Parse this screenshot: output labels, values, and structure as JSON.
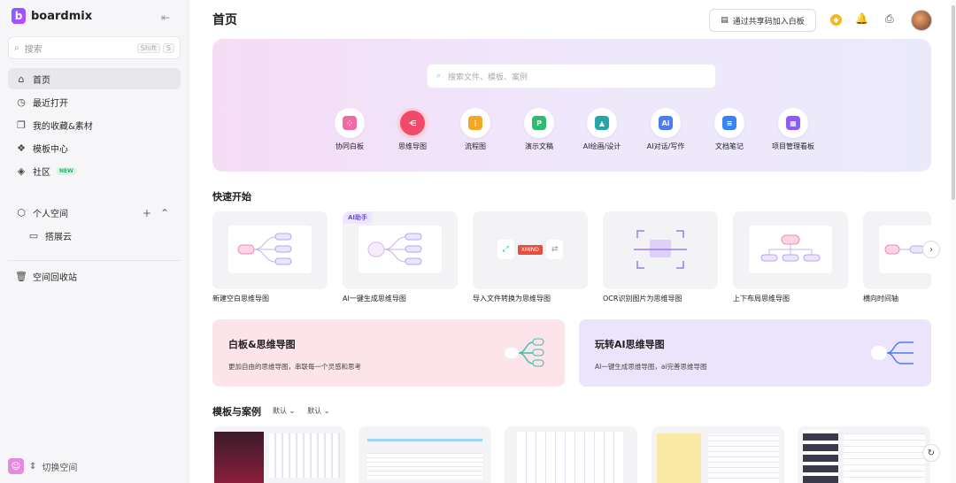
{
  "sidebar": {
    "brand": "boardmix",
    "search": {
      "placeholder": "搜索",
      "kbd": [
        "Shift",
        "S"
      ]
    },
    "nav": [
      {
        "label": "首页",
        "icon": "home-icon"
      },
      {
        "label": "最近打开",
        "icon": "clock-icon"
      },
      {
        "label": "我的收藏&素材",
        "icon": "collection-icon"
      },
      {
        "label": "模板中心",
        "icon": "template-icon"
      },
      {
        "label": "社区",
        "icon": "compass-icon",
        "badge": "NEW"
      }
    ],
    "personal_space": "个人空间",
    "folder": "搭展云",
    "trash": "空间回收站",
    "switch_space": "切换空间"
  },
  "header": {
    "title": "首页",
    "join_button": "通过共享码加入白板"
  },
  "hero": {
    "search_placeholder": "搜索文件、模板、案例",
    "tools": [
      {
        "label": "协同白板",
        "color": "#f26aa3"
      },
      {
        "label": "思维导图",
        "color": "#ef4a6a"
      },
      {
        "label": "流程图",
        "color": "#f5a623"
      },
      {
        "label": "演示文稿",
        "color": "#2ebd6e"
      },
      {
        "label": "AI绘画/设计",
        "color": "#27a6a8"
      },
      {
        "label": "AI对话/写作",
        "color": "#4a7cf2"
      },
      {
        "label": "文档笔记",
        "color": "#3a83f5"
      },
      {
        "label": "项目管理看板",
        "color": "#8b5cf6"
      }
    ]
  },
  "quick_start": {
    "title": "快速开始",
    "ai_tag": "AI助手",
    "cards": [
      {
        "label": "新建空白思维导图"
      },
      {
        "label": "AI一键生成思维导图"
      },
      {
        "label": "导入文件转换为思维导图",
        "tag": "XMIND"
      },
      {
        "label": "OCR识别图片为思维导图"
      },
      {
        "label": "上下布局思维导图"
      },
      {
        "label": "横向时间轴"
      }
    ]
  },
  "promos": [
    {
      "title": "白板&思维导图",
      "desc": "更加自由的思维导图，串联每一个灵感和思考",
      "bg": "#fde3ea"
    },
    {
      "title": "玩转AI思维导图",
      "desc": "AI一键生成思维导图，ai完善思维导图",
      "bg": "#ebe4fb"
    }
  ],
  "templates": {
    "title": "模板与案例",
    "filters": [
      "默认",
      "默认"
    ]
  }
}
